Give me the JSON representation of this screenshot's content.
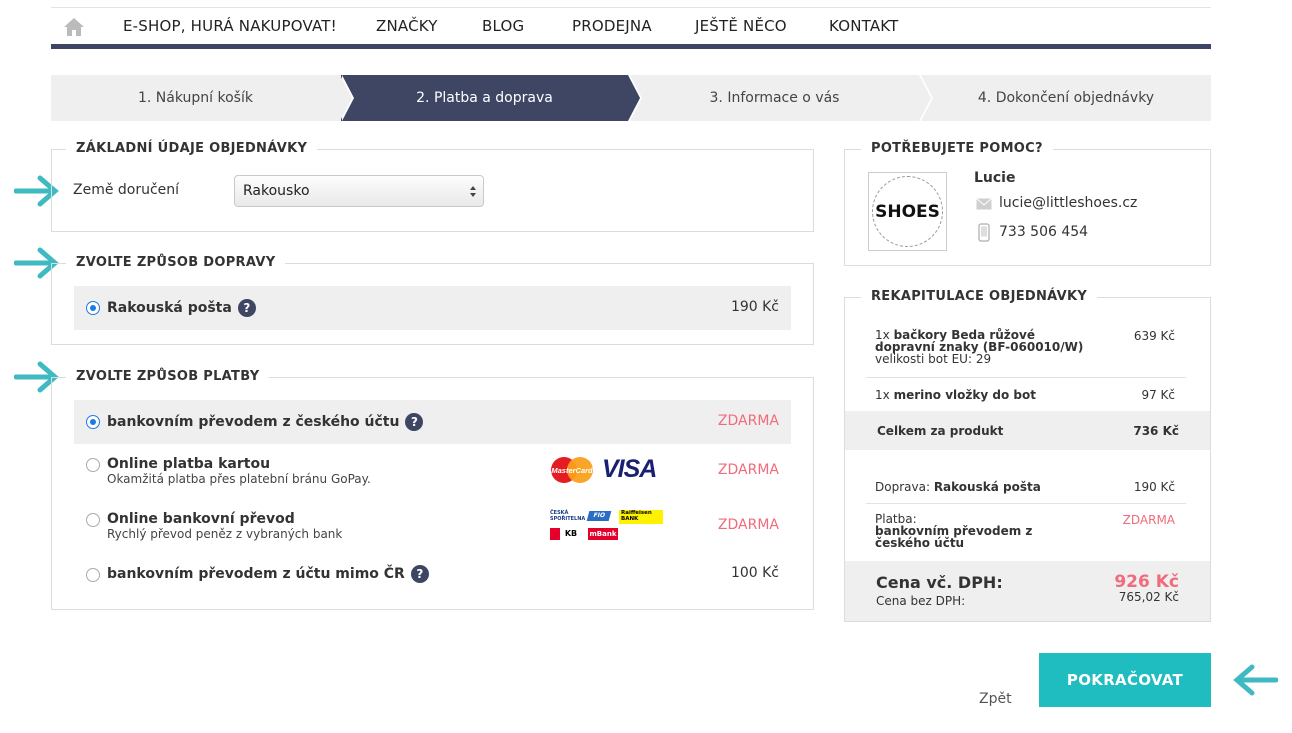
{
  "nav": {
    "items": [
      "E-SHOP, HURÁ NAKUPOVAT!",
      "ZNAČKY",
      "BLOG",
      "PRODEJNA",
      "JEŠTĚ NĚCO",
      "KONTAKT"
    ]
  },
  "steps": [
    "1. Nákupní košík",
    "2. Platba a doprava",
    "3. Informace o vás",
    "4. Dokončení objednávky"
  ],
  "basic": {
    "legend": "ZÁKLADNÍ ÚDAJE OBJEDNÁVKY",
    "country_label": "Země doručení",
    "country_value": "Rakousko"
  },
  "shipping": {
    "legend": "ZVOLTE ZPŮSOB DOPRAVY",
    "options": [
      {
        "label": "Rakouská pošta",
        "price": "190 Kč"
      }
    ]
  },
  "payment": {
    "legend": "ZVOLTE ZPŮSOB PLATBY",
    "options": [
      {
        "label": "bankovním převodem z českého účtu",
        "sub": "",
        "price": "ZDARMA"
      },
      {
        "label": "Online platba kartou",
        "sub": "Okamžitá platba přes platební bránu GoPay.",
        "price": "ZDARMA"
      },
      {
        "label": "Online bankovní převod",
        "sub": "Rychlý převod peněz z vybraných bank",
        "price": "ZDARMA"
      },
      {
        "label": "bankovním převodem z účtu mimo ČR",
        "sub": "",
        "price": "100 Kč"
      }
    ],
    "card_logos": [
      "MasterCard",
      "VISA"
    ],
    "bank_logos": [
      "ČESKÁ SPOŘITELNA",
      "FIO",
      "Raiffeisen BANK",
      "KB",
      "mBank"
    ]
  },
  "help": {
    "legend": "POTŘEBUJETE POMOC?",
    "logo_text": "SHOES",
    "name": "Lucie",
    "email": "lucie@littleshoes.cz",
    "phone": "733 506 454"
  },
  "summary": {
    "legend": "REKAPITULACE OBJEDNÁVKY",
    "item1_qty": "1x",
    "item1_name": "bačkory Beda růžové dopravní znaky (BF-060010/W)",
    "item1_detail": "velikosti bot EU: 29",
    "item1_price": "639 Kč",
    "item2_qty": "1x",
    "item2_name": "merino vložky do bot",
    "item2_price": "97 Kč",
    "products_label": "Celkem za produkt",
    "products_total": "736 Kč",
    "shipping_label": "Doprava:",
    "shipping_value": "Rakouská pošta",
    "shipping_price": "190 Kč",
    "payment_label": "Platba:",
    "payment_value": "bankovním převodem z českého účtu",
    "payment_price": "ZDARMA",
    "total_label": "Cena vč. DPH:",
    "total_value": "926 Kč",
    "net_label": "Cena bez DPH:",
    "net_value": "765,02 Kč"
  },
  "actions": {
    "back": "Zpět",
    "continue": "POKRAČOVAT"
  },
  "colors": {
    "navy": "#3e4664",
    "teal": "#1fbcc0",
    "pink": "#f06b7c",
    "radio": "#1f7be0"
  }
}
